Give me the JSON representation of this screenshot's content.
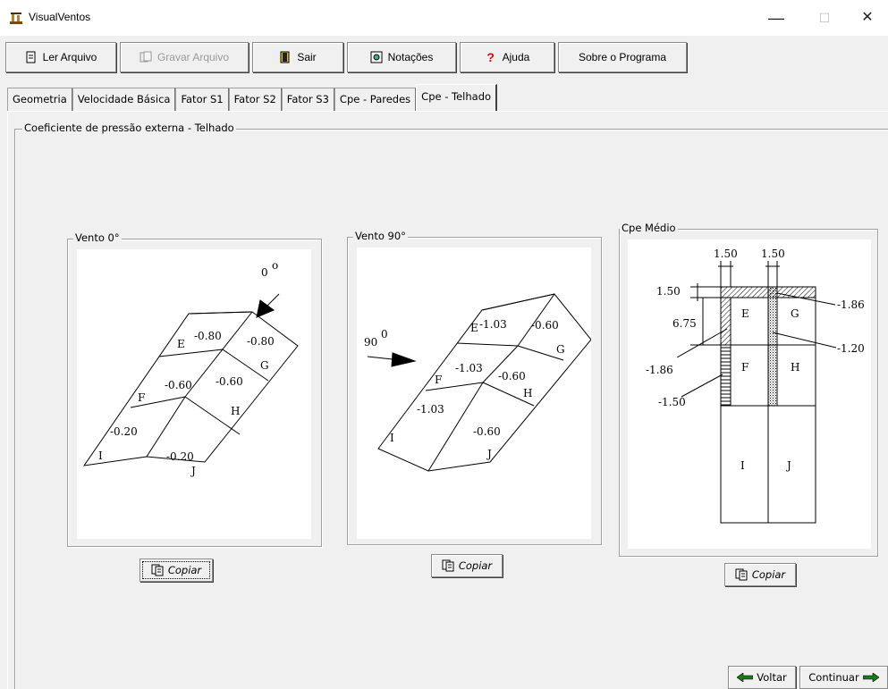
{
  "window": {
    "title": "VisualVentos",
    "minimize": "—",
    "maximize": "☐",
    "close": "✕"
  },
  "toolbar": {
    "ler": "Ler Arquivo",
    "gravar": "Gravar Arquivo",
    "sair": "Sair",
    "notacoes": "Notações",
    "ajuda": "Ajuda",
    "sobre": "Sobre o Programa"
  },
  "tabs": [
    "Geometria",
    "Velocidade Básica",
    "Fator S1",
    "Fator S2",
    "Fator S3",
    "Cpe - Paredes",
    "Cpe - Telhado"
  ],
  "panel_title": "Coeficiente de pressão externa - Telhado",
  "vento0": {
    "label": "Vento 0°",
    "angle": "0",
    "deg": "o",
    "zones": {
      "E": "E",
      "F": "F",
      "G": "G",
      "H": "H",
      "I": "I",
      "J": "J"
    },
    "values": {
      "E": "-0.80",
      "G": "-0.80",
      "F": "-0.60",
      "H": "-0.60",
      "I": "-0.20",
      "J": "-0.20"
    }
  },
  "vento90": {
    "label": "Vento 90°",
    "angle": "90",
    "deg": "0",
    "zones": {
      "E": "E",
      "F": "F",
      "G": "G",
      "H": "H",
      "I": "I",
      "J": "J"
    },
    "values": {
      "E": "-1.03",
      "G": "-0.60",
      "F": "-1.03",
      "H": "-0.60",
      "I": "-1.03",
      "J": "-0.60"
    }
  },
  "medio": {
    "label": "Cpe Médio",
    "dim_left": "1.50",
    "dim_right": "1.50",
    "dim_side_top": "1.50",
    "dim_side": "6.75",
    "zones": {
      "E": "E",
      "F": "F",
      "G": "G",
      "H": "H",
      "I": "I",
      "J": "J"
    },
    "callouts": {
      "top_right": "-1.86",
      "mid_right": "-1.20",
      "left_upper": "-1.86",
      "left_lower": "-1.50"
    }
  },
  "copy_label": "Copiar",
  "nav": {
    "voltar": "Voltar",
    "continuar": "Continuar"
  }
}
